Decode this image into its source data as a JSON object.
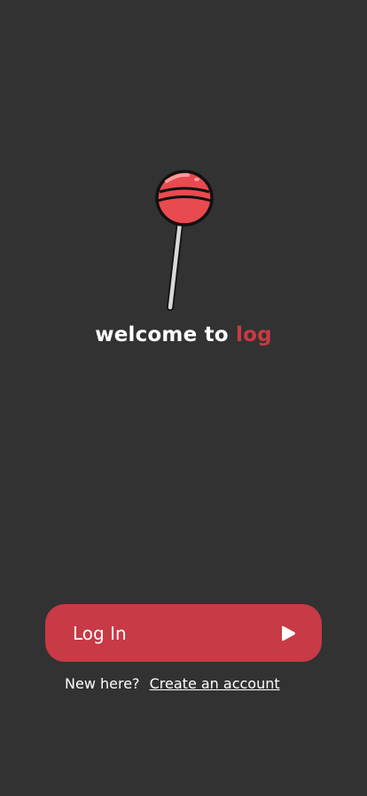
{
  "logo": {
    "icon": "lollipop-icon"
  },
  "welcome": {
    "prefix": "welcome to ",
    "brand": "log"
  },
  "login_button": {
    "label": "Log In",
    "icon": "play-arrow-icon"
  },
  "signup": {
    "prompt": "New here?",
    "link_label": "Create an account"
  },
  "colors": {
    "background": "#323232",
    "accent": "#c83a45",
    "text": "#ffffff"
  }
}
